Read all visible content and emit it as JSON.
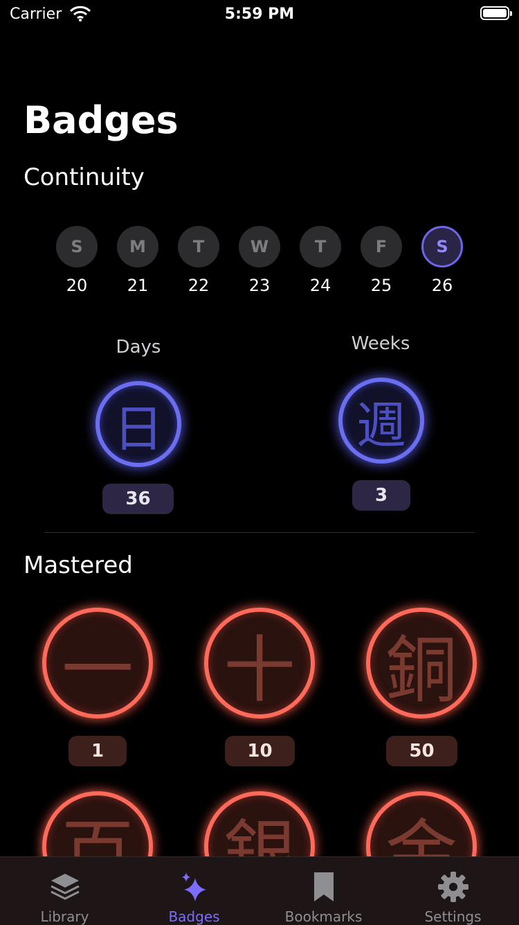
{
  "status_bar": {
    "carrier": "Carrier",
    "time": "5:59 PM"
  },
  "page": {
    "title": "Badges"
  },
  "continuity": {
    "title": "Continuity",
    "days": [
      {
        "letter": "S",
        "date": "20"
      },
      {
        "letter": "M",
        "date": "21"
      },
      {
        "letter": "T",
        "date": "22"
      },
      {
        "letter": "W",
        "date": "23"
      },
      {
        "letter": "T",
        "date": "24"
      },
      {
        "letter": "F",
        "date": "25"
      },
      {
        "letter": "S",
        "date": "26"
      }
    ],
    "days_label": "Days",
    "days_count": "36",
    "weeks_label": "Weeks",
    "weeks_count": "3"
  },
  "mastered": {
    "title": "Mastered",
    "badges": [
      {
        "kanji": "一",
        "count": "1"
      },
      {
        "kanji": "十",
        "count": "10"
      },
      {
        "kanji": "銅",
        "count": "50"
      },
      {
        "kanji": "百",
        "count": ""
      },
      {
        "kanji": "銀",
        "count": ""
      },
      {
        "kanji": "金",
        "count": ""
      }
    ]
  },
  "tabs": [
    {
      "label": "Library",
      "icon": "layers-icon"
    },
    {
      "label": "Badges",
      "icon": "sparkles-icon"
    },
    {
      "label": "Bookmarks",
      "icon": "bookmark-icon"
    },
    {
      "label": "Settings",
      "icon": "gear-icon"
    }
  ],
  "colors": {
    "accent_purple": "#7c6cff",
    "badge_blue": "#6b6ef0",
    "badge_red": "#ff6a5a",
    "background": "#000000"
  }
}
